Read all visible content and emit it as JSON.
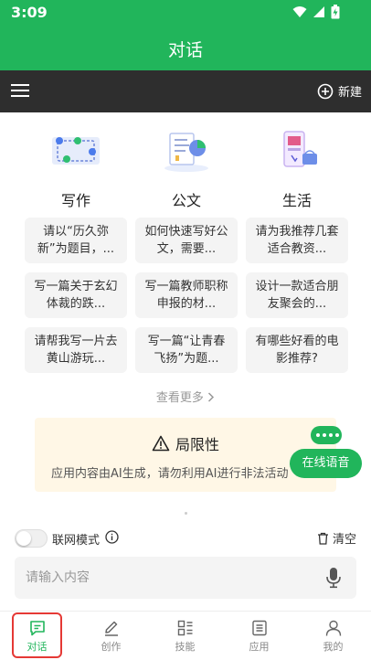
{
  "status": {
    "time": "3:09"
  },
  "header": {
    "title": "对话"
  },
  "toolbar": {
    "new_label": "新建"
  },
  "categories": [
    {
      "title": "写作",
      "icon": "writing-illustration-icon",
      "prompts": [
        "请以“历久弥新”为题目，...",
        "写一篇关于玄幻体裁的跌...",
        "请帮我写一片去黄山游玩..."
      ]
    },
    {
      "title": "公文",
      "icon": "document-chart-illustration-icon",
      "prompts": [
        "如何快速写好公文，需要...",
        "写一篇教师职称申报的材...",
        "写一篇“让青春飞扬”为题..."
      ]
    },
    {
      "title": "生活",
      "icon": "shopping-phone-illustration-icon",
      "prompts": [
        "请为我推荐几套适合教资...",
        "设计一款适合朋友聚会的...",
        "有哪些好看的电影推荐?"
      ]
    }
  ],
  "see_more": "查看更多",
  "limitation": {
    "title": "局限性",
    "text": "应用内容由AI生成，请勿利用AI进行非法活动"
  },
  "voice": {
    "label": "在线语音"
  },
  "controls": {
    "online_mode": "联网模式",
    "clear": "清空"
  },
  "input": {
    "placeholder": "请输入内容"
  },
  "nav": [
    {
      "label": "对话",
      "icon": "chat-icon",
      "active": true
    },
    {
      "label": "创作",
      "icon": "pen-icon",
      "active": false
    },
    {
      "label": "技能",
      "icon": "skills-grid-icon",
      "active": false
    },
    {
      "label": "应用",
      "icon": "app-list-icon",
      "active": false
    },
    {
      "label": "我的",
      "icon": "profile-icon",
      "active": false
    }
  ],
  "colors": {
    "primary": "#21b55b",
    "toolbar": "#2e2e2e",
    "highlight": "#e53935",
    "notice_bg": "#fff7e6"
  }
}
